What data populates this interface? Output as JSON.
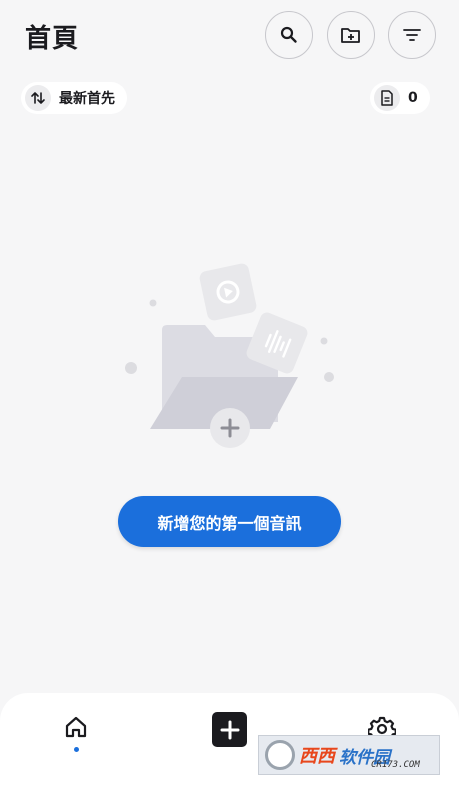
{
  "header": {
    "title": "首頁",
    "search_icon": "search-icon",
    "new_folder_icon": "folder-plus-icon",
    "filter_icon": "filter-icon"
  },
  "toolbar": {
    "sort_label": "最新首先",
    "sort_icon": "sort-arrows-icon",
    "count": "0",
    "count_icon": "document-icon"
  },
  "empty_state": {
    "cta_label": "新增您的第一個音訊"
  },
  "bottom_nav": {
    "home_icon": "home-icon",
    "add_icon": "plus-icon",
    "settings_icon": "gear-icon"
  },
  "watermark": {
    "brand_a": "西西",
    "brand_b": "软件园",
    "domain": "CR173.COM"
  },
  "colors": {
    "accent": "#1b6fdc",
    "background": "#f6f6f7"
  }
}
